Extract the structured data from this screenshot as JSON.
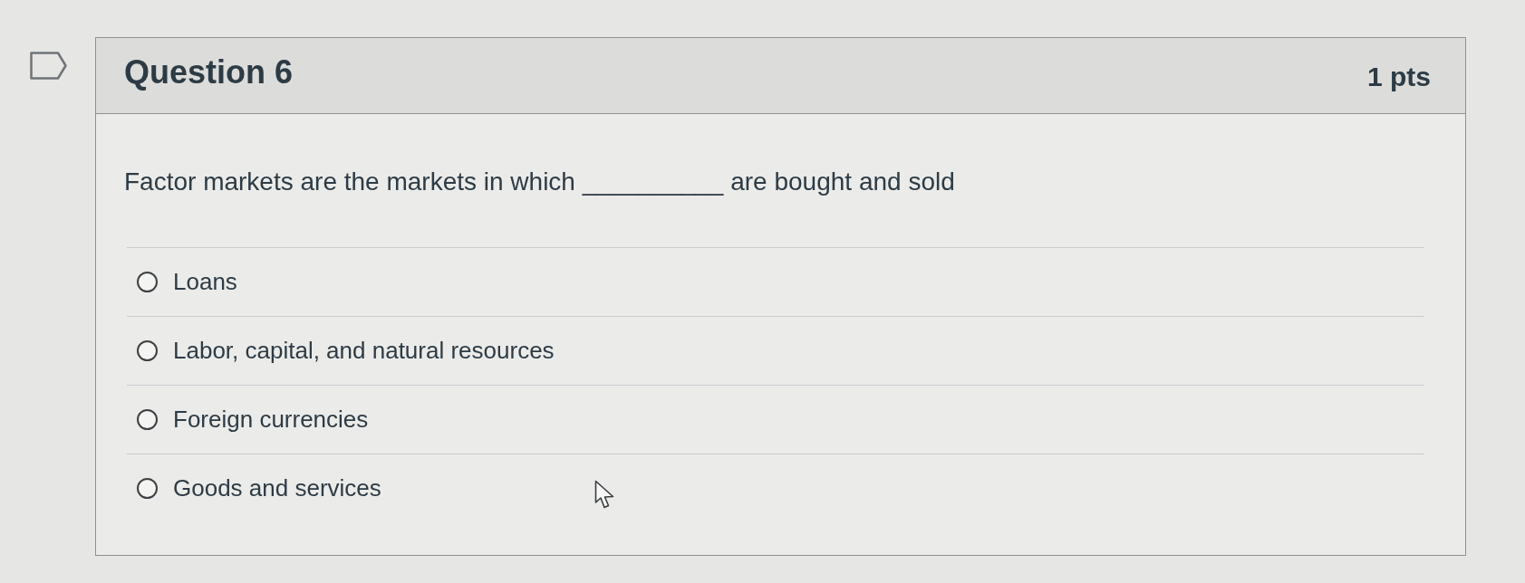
{
  "question": {
    "title": "Question 6",
    "points": "1 pts",
    "text": "Factor markets are the markets in which __________ are bought and sold"
  },
  "options": [
    {
      "label": "Loans",
      "selected": false
    },
    {
      "label": "Labor, capital, and natural resources",
      "selected": false
    },
    {
      "label": "Foreign currencies",
      "selected": false
    },
    {
      "label": "Goods and services",
      "selected": false
    }
  ]
}
